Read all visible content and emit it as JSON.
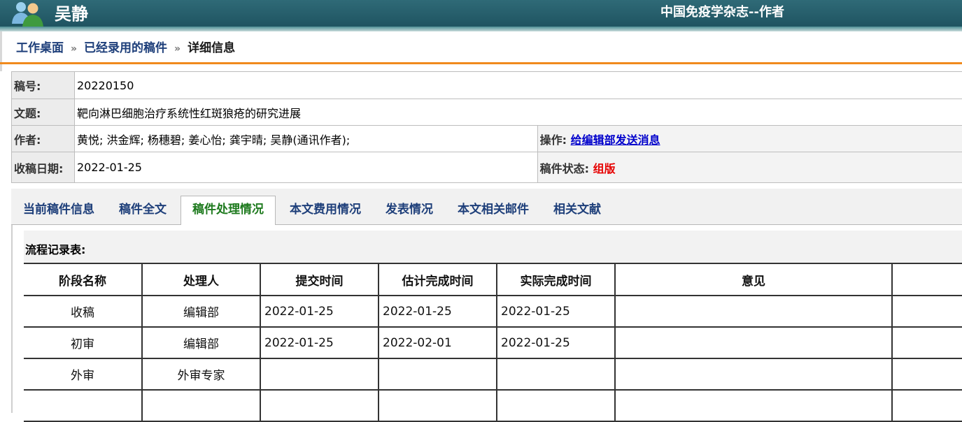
{
  "header": {
    "user_name": "吴静",
    "journal_title": "中国免疫学杂志--作者"
  },
  "breadcrumb": {
    "items": [
      "工作桌面",
      "已经录用的稿件"
    ],
    "separator": "»",
    "current": "详细信息"
  },
  "manuscript": {
    "id_label": "稿号:",
    "id_value": "20220150",
    "title_label": "文题:",
    "title_value": "靶向淋巴细胞治疗系统性红斑狼疮的研究进展",
    "authors_label": "作者:",
    "authors_value": "黄悦; 洪金辉; 杨穗碧; 姜心怡; 龚宇晴; 吴静(通讯作者);",
    "action_label": "操作:",
    "action_link": "给编辑部发送消息",
    "received_label": "收稿日期:",
    "received_value": "2022-01-25",
    "status_label": "稿件状态:",
    "status_value": "组版"
  },
  "tabs": [
    {
      "label": "当前稿件信息",
      "active": false
    },
    {
      "label": "稿件全文",
      "active": false
    },
    {
      "label": "稿件处理情况",
      "active": true
    },
    {
      "label": "本文费用情况",
      "active": false
    },
    {
      "label": "发表情况",
      "active": false
    },
    {
      "label": "本文相关邮件",
      "active": false
    },
    {
      "label": "相关文献",
      "active": false
    }
  ],
  "flow": {
    "title": "流程记录表:",
    "columns": [
      "阶段名称",
      "处理人",
      "提交时间",
      "估计完成时间",
      "实际完成时间",
      "意见",
      ""
    ],
    "rows": [
      [
        "收稿",
        "编辑部",
        "2022-01-25",
        "2022-01-25",
        "2022-01-25",
        "",
        ""
      ],
      [
        "初审",
        "编辑部",
        "2022-01-25",
        "2022-02-01",
        "2022-01-25",
        "",
        ""
      ],
      [
        "外审",
        "外审专家",
        "",
        "",
        "",
        "",
        ""
      ],
      [
        "",
        "",
        "",
        "",
        "",
        "",
        ""
      ]
    ]
  },
  "colors": {
    "header_bg": "#2a6270",
    "accent_orange": "#f08a1d",
    "link_blue": "#1e3f7a",
    "active_tab_green": "#1e7a1e",
    "status_red": "#e60000"
  }
}
